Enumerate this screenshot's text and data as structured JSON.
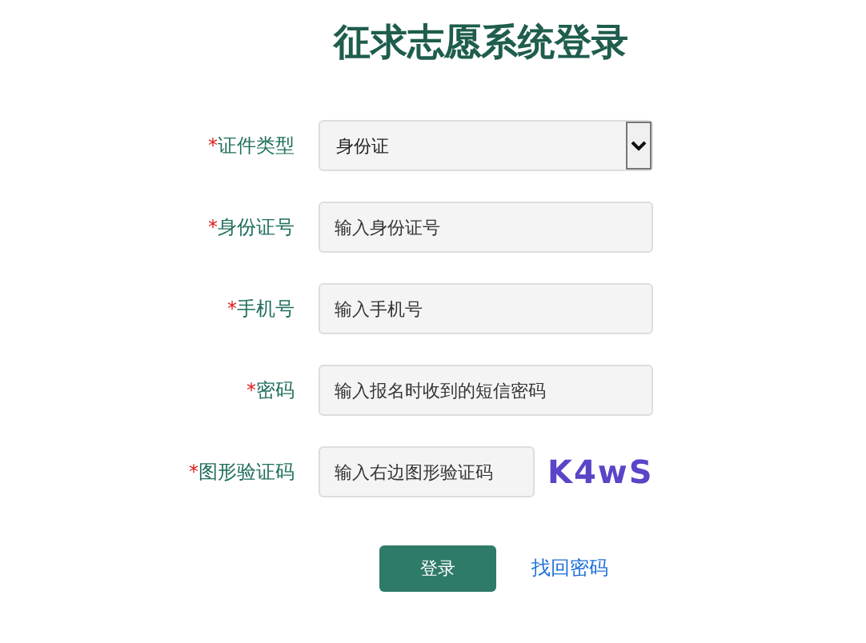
{
  "title": "征求志愿系统登录",
  "fields": [
    {
      "kind": "select",
      "mark": "*",
      "label": "证件类型",
      "value": "身份证"
    },
    {
      "kind": "input",
      "mark": "*",
      "label": "身份证号",
      "placeholder": "输入身份证号"
    },
    {
      "kind": "input",
      "mark": "*",
      "label": "手机号",
      "placeholder": "输入手机号"
    },
    {
      "kind": "input",
      "mark": "*",
      "label": "密码",
      "placeholder": "输入报名时收到的短信密码"
    },
    {
      "kind": "captcha",
      "mark": "*",
      "label": "图形验证码",
      "placeholder": "输入右边图形验证码",
      "captcha": "K4wS"
    }
  ],
  "login_button": "登录",
  "recover_link": "找回密码"
}
